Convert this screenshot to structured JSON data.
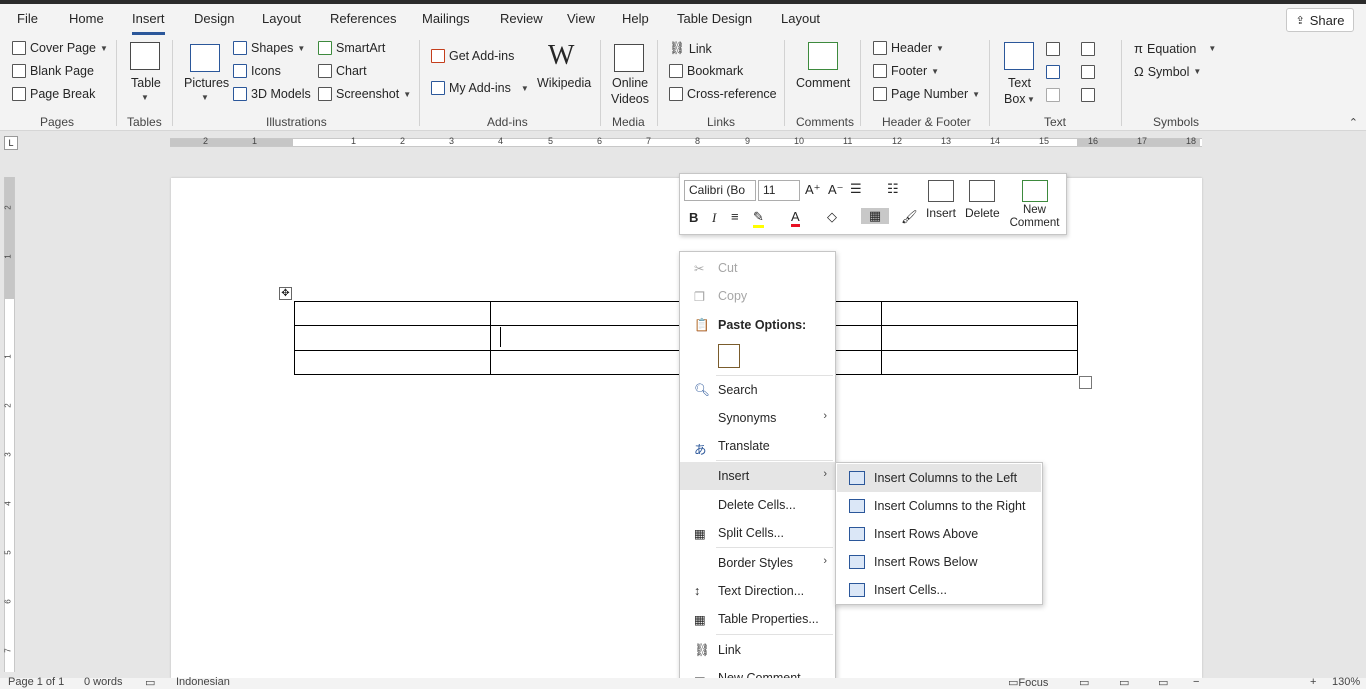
{
  "colors": {
    "accent": "#2b579a",
    "ribbon_bg": "#f3f3f3",
    "canvas_bg": "#e6e6e6",
    "hover": "#e5e5e5"
  },
  "menubar": {
    "tabs": [
      "File",
      "Home",
      "Insert",
      "Design",
      "Layout",
      "References",
      "Mailings",
      "Review",
      "View",
      "Help",
      "Table Design",
      "Layout"
    ],
    "active_tab": "Insert",
    "share_label": "Share"
  },
  "ribbon": {
    "groups": {
      "pages": "Pages",
      "tables": "Tables",
      "illustrations": "Illustrations",
      "addins": "Add-ins",
      "media": "Media",
      "links": "Links",
      "comments": "Comments",
      "header_footer": "Header & Footer",
      "text": "Text",
      "symbols": "Symbols"
    },
    "pages": {
      "cover_page": "Cover Page",
      "blank_page": "Blank Page",
      "page_break": "Page Break"
    },
    "tables": {
      "table": "Table"
    },
    "illustrations": {
      "pictures": "Pictures",
      "shapes": "Shapes",
      "icons": "Icons",
      "models_3d": "3D Models",
      "smartart": "SmartArt",
      "chart": "Chart",
      "screenshot": "Screenshot"
    },
    "addins": {
      "get_addins": "Get Add-ins",
      "my_addins": "My Add-ins",
      "wikipedia": "Wikipedia"
    },
    "media": {
      "online_videos_1": "Online",
      "online_videos_2": "Videos"
    },
    "links": {
      "link": "Link",
      "bookmark": "Bookmark",
      "cross_reference": "Cross-reference"
    },
    "comments": {
      "comment": "Comment"
    },
    "header_footer": {
      "header": "Header",
      "footer": "Footer",
      "page_number": "Page Number"
    },
    "text": {
      "text_box_1": "Text",
      "text_box_2": "Box"
    },
    "symbols": {
      "equation": "Equation",
      "symbol": "Symbol"
    }
  },
  "ruler": {
    "h_numbers": [
      "2",
      "1",
      "1",
      "2",
      "3",
      "4",
      "5",
      "6",
      "7",
      "8",
      "9",
      "10",
      "11",
      "12",
      "13",
      "14",
      "15",
      "16",
      "17",
      "18"
    ],
    "v_numbers": [
      "2",
      "1",
      "1",
      "2",
      "3",
      "4",
      "5",
      "6",
      "7"
    ]
  },
  "minibar": {
    "font": "Calibri (Bo",
    "size": "11",
    "insert": "Insert",
    "delete": "Delete",
    "new_comment_1": "New",
    "new_comment_2": "Comment"
  },
  "context_menu": {
    "cut": "Cut",
    "copy": "Copy",
    "paste_options": "Paste Options:",
    "search": "Search",
    "synonyms": "Synonyms",
    "translate": "Translate",
    "insert": "Insert",
    "delete_cells": "Delete Cells...",
    "split_cells": "Split Cells...",
    "border_styles": "Border Styles",
    "text_direction": "Text Direction...",
    "table_properties": "Table Properties...",
    "link": "Link",
    "new_comment": "New Comment"
  },
  "insert_submenu": {
    "cols_left": "Insert Columns to the Left",
    "cols_right": "Insert Columns to the Right",
    "rows_above": "Insert Rows Above",
    "rows_below": "Insert Rows Below",
    "cells": "Insert Cells..."
  },
  "statusbar": {
    "page": "Page 1 of 1",
    "words": "0 words",
    "language": "Indonesian",
    "focus": "Focus",
    "zoom": "130%"
  }
}
